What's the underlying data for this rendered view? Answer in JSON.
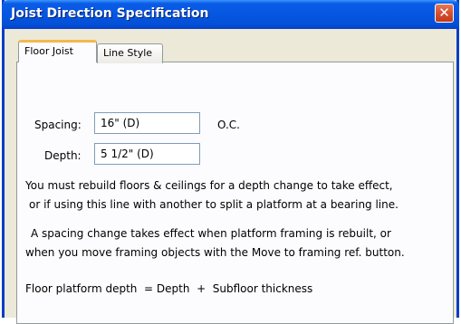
{
  "window": {
    "title": "Joist Direction Specification",
    "close_glyph": "✕"
  },
  "tabs": [
    {
      "label": "Floor Joist",
      "active": true
    },
    {
      "label": "Line Style",
      "active": false
    }
  ],
  "form": {
    "spacing_label": "Spacing:",
    "spacing_value": "16\" (D)",
    "spacing_suffix": "O.C.",
    "depth_label": "Depth:",
    "depth_value": "5 1/2\" (D)"
  },
  "notes": {
    "para1_line1": "You must rebuild floors & ceilings for a depth change to take effect,",
    "para1_line2": "or if using this line with another to split a platform at a bearing line.",
    "para2_line1": "A spacing change takes effect when platform framing is rebuilt, or",
    "para2_line2": "when you move framing objects with the Move to framing ref. button.",
    "formula": "Floor platform depth  = Depth  +  Subfloor thickness"
  }
}
